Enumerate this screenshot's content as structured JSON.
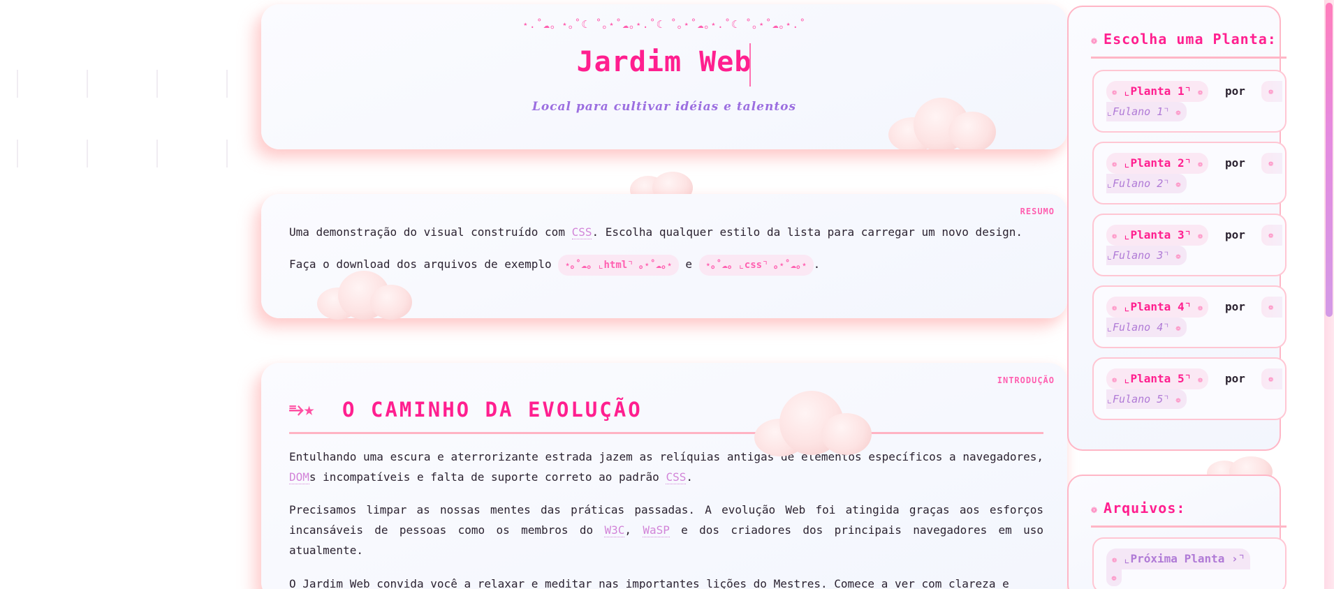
{
  "header": {
    "sparkles": "⋆.˚☁︎。⋆｡˚☾ ˚｡⋆˚☁︎｡⋆.˚☾ ˚｡⋆˚☁︎｡⋆.˚☾ ˚｡⋆˚☁︎｡⋆.˚",
    "title": "Jardim Web",
    "subtitle": "Local para cultivar idéias e talentos"
  },
  "resumo": {
    "tag": "RESUMO",
    "line1_before": "Uma demonstração do visual construído com ",
    "line1_abbr": "CSS",
    "line1_after": ". Escolha qualquer estilo da lista para carregar um novo design.",
    "line2_before": "Faça o download dos arquivos de exemplo ",
    "html_link": "⋆｡˚☁︎｡ ⌞html⌝ ｡⋆˚☁︎｡⋆",
    "and": " e ",
    "css_link": "⋆｡˚☁︎｡ ⌞css⌝ ｡⋆˚☁︎｡⋆",
    "line2_after": "."
  },
  "intro": {
    "tag": "INTRODUÇÃO",
    "heading_icon": "⥱★",
    "heading": "O CAMINHO DA EVOLUÇÃO",
    "p1_a": "Entulhando uma escura e aterrorizante estrada jazem as relíquias antigas de elementos específicos a navegadores, ",
    "p1_abbr1": "DOM",
    "p1_b": "s incompatíveis e falta de suporte correto ao padrão ",
    "p1_abbr2": "CSS",
    "p1_c": ".",
    "p2_a": "Precisamos limpar as nossas mentes das práticas passadas. A evolução Web foi atingida graças aos esforços incansáveis de pessoas como os membros do ",
    "p2_abbr1": "W3C",
    "p2_b": ", ",
    "p2_abbr2": "WaSP",
    "p2_c": " e dos criadores dos principais navegadores em uso atualmente.",
    "p3": "O Jardim Web convida você a relaxar e meditar nas importantes lições do Mestres. Comece a ver com clareza e"
  },
  "sidebar": {
    "plants_title": "Escolha uma Planta:",
    "flower_glyph": "❁",
    "por_label": "por",
    "plants": [
      {
        "name": "⌞Planta 1⌝",
        "author": "⌞Fulano 1⌝"
      },
      {
        "name": "⌞Planta 2⌝",
        "author": "⌞Fulano 2⌝"
      },
      {
        "name": "⌞Planta 3⌝",
        "author": "⌞Fulano 3⌝"
      },
      {
        "name": "⌞Planta 4⌝",
        "author": "⌞Fulano 4⌝"
      },
      {
        "name": "⌞Planta 5⌝",
        "author": "⌞Fulano 5⌝"
      }
    ],
    "files_title": "Arquivos:",
    "next_label": "⌞Próxima Planta ›⌝"
  },
  "colors": {
    "accent_pink": "#ff1f8f",
    "lavender": "#b07ad6",
    "border_pink": "#ffb6c6"
  }
}
